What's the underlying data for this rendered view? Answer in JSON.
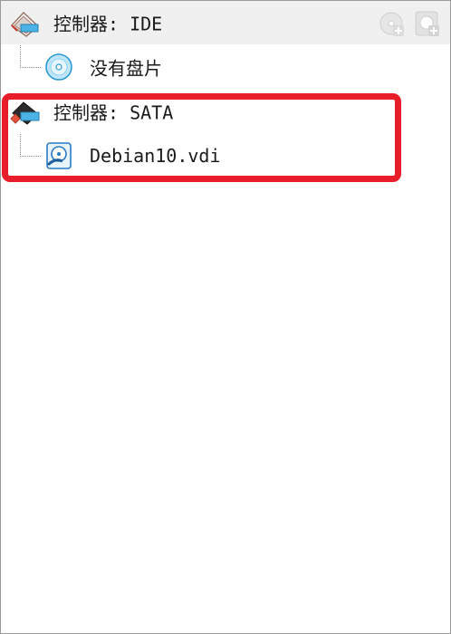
{
  "storage_tree": {
    "controllers": [
      {
        "label": "控制器: IDE",
        "icon": "ide-controller-icon",
        "attachments": [
          {
            "label": "没有盘片",
            "icon": "optical-disc-icon"
          }
        ]
      },
      {
        "label": "控制器: SATA",
        "icon": "sata-controller-icon",
        "attachments": [
          {
            "label": "Debian10.vdi",
            "icon": "hard-disk-icon"
          }
        ]
      }
    ]
  },
  "toolbar": {
    "add_optical_icon": "add-optical-drive-icon",
    "add_hard_disk_icon": "add-hard-disk-icon"
  },
  "colors": {
    "highlight": "#e81d2a",
    "header_background": "#f0f0f0"
  }
}
